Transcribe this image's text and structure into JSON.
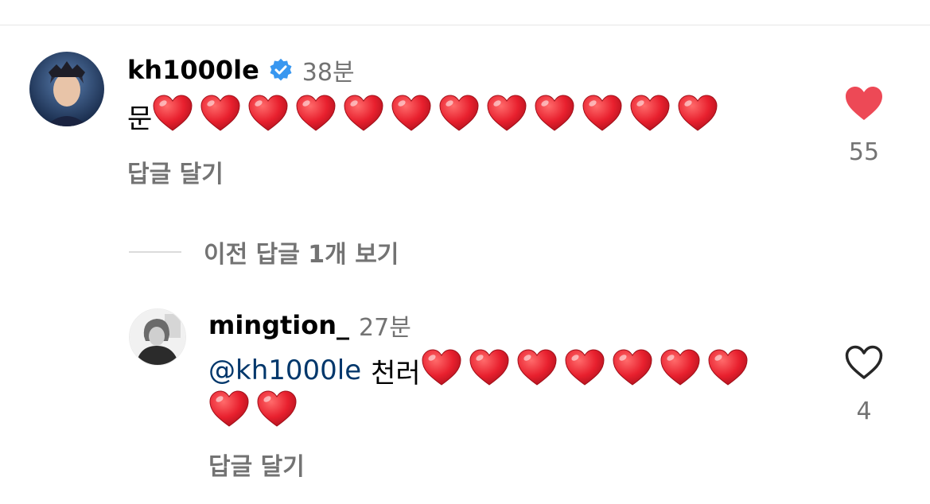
{
  "comments": [
    {
      "username": "kh1000le",
      "time": "38분",
      "text_prefix": "문",
      "mention": "",
      "heart_count": 12,
      "reply_label": "답글 달기",
      "like_count": "55",
      "liked": true,
      "verified": true
    },
    {
      "username": "mingtion_",
      "time": "27분",
      "text_prefix": "천러",
      "mention": "@kh1000le",
      "heart_count_line1": 7,
      "heart_count_line2": 2,
      "reply_label": "답글 달기",
      "like_count": "4",
      "liked": false,
      "verified": false
    }
  ],
  "view_previous_replies": "이전 답글 1개 보기",
  "colors": {
    "like_red": "#ed4956",
    "verified_blue": "#3897f0",
    "mention": "#00376b",
    "secondary_text": "#737373"
  },
  "icons": [
    "verified-badge-icon",
    "heart-filled-icon",
    "heart-outline-icon",
    "red-heart-emoji"
  ]
}
